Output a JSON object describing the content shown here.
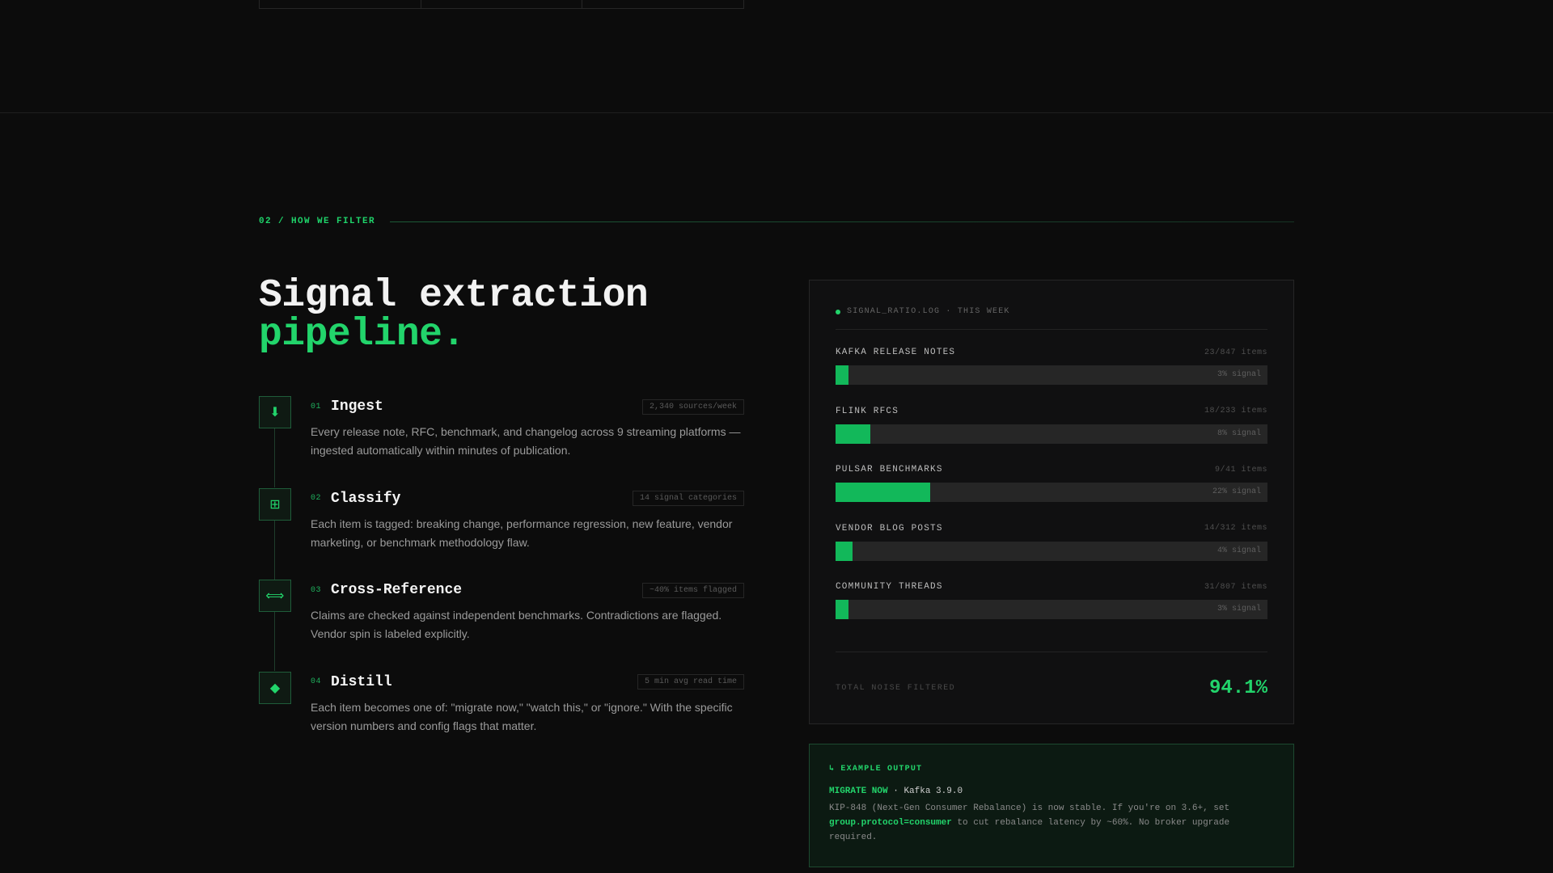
{
  "section": {
    "label": "02 / HOW WE FILTER",
    "title_line1": "Signal extraction",
    "title_line2": "pipeline."
  },
  "steps": [
    {
      "num": "01",
      "title": "Ingest",
      "icon": "download-arrow-icon",
      "glyph": "⬇",
      "tag": "2,340 sources/week",
      "desc": "Every release note, RFC, benchmark, and changelog across 9 streaming platforms — ingested automatically within minutes of publication."
    },
    {
      "num": "02",
      "title": "Classify",
      "icon": "grid-icon",
      "glyph": "⊞",
      "tag": "14 signal categories",
      "desc": "Each item is tagged: breaking change, performance regression, new feature, vendor marketing, or benchmark methodology flaw."
    },
    {
      "num": "03",
      "title": "Cross-Reference",
      "icon": "double-arrow-icon",
      "glyph": "⟺",
      "tag": "~40% items flagged",
      "desc": "Claims are checked against independent benchmarks. Contradictions are flagged. Vendor spin is labeled explicitly."
    },
    {
      "num": "04",
      "title": "Distill",
      "icon": "diamond-icon",
      "glyph": "◆",
      "tag": "5 min avg read time",
      "desc": "Each item becomes one of: \"migrate now,\" \"watch this,\" or \"ignore.\" With the specific version numbers and config flags that matter."
    }
  ],
  "signal_card": {
    "header": "SIGNAL_RATIO.LOG · THIS WEEK",
    "rows": [
      {
        "name": "KAFKA RELEASE NOTES",
        "count": "23/847 items",
        "signal_label": "3% signal",
        "fraction": 0.03
      },
      {
        "name": "FLINK RFCS",
        "count": "18/233 items",
        "signal_label": "8% signal",
        "fraction": 0.08
      },
      {
        "name": "PULSAR BENCHMARKS",
        "count": "9/41 items",
        "signal_label": "22% signal",
        "fraction": 0.22
      },
      {
        "name": "VENDOR BLOG POSTS",
        "count": "14/312 items",
        "signal_label": "4% signal",
        "fraction": 0.04
      },
      {
        "name": "COMMUNITY THREADS",
        "count": "31/807 items",
        "signal_label": "3% signal",
        "fraction": 0.03
      }
    ],
    "total_label": "TOTAL NOISE FILTERED",
    "total_value": "94.1%"
  },
  "example": {
    "label": "↳ EXAMPLE OUTPUT",
    "tag": "MIGRATE NOW",
    "separator": " · ",
    "subject": "Kafka 3.9.0",
    "body_pre": "KIP-848 (Next-Gen Consumer Rebalance) is now stable. If you're on 3.6+, set ",
    "body_code": "group.protocol=consumer",
    "body_post": " to cut rebalance latency by ~60%. No broker upgrade required."
  },
  "colors": {
    "accent": "#22d46b",
    "bar_fill": "#12b85a",
    "background": "#0c0c0c"
  }
}
